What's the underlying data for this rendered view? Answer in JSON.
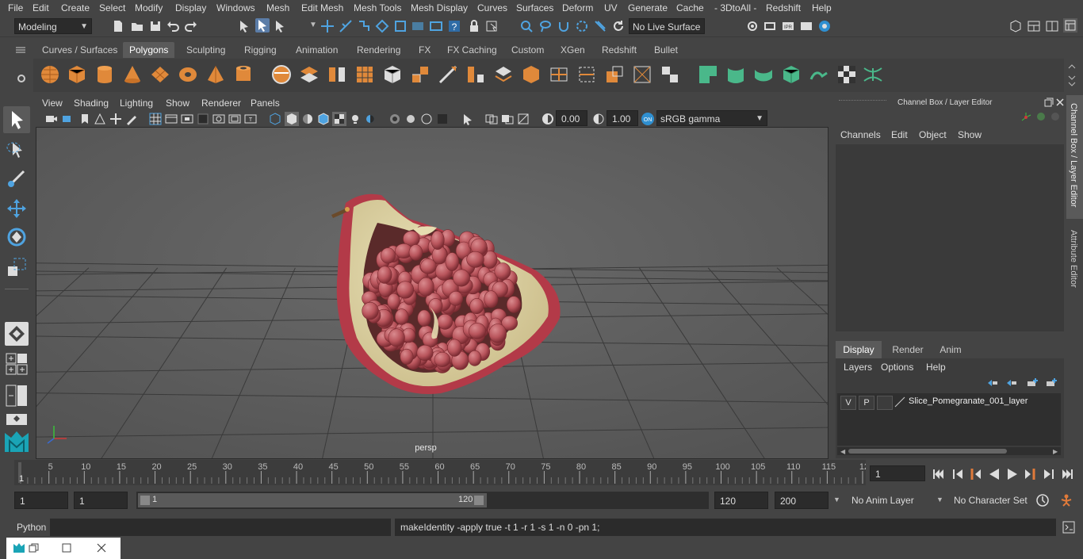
{
  "menu": [
    "File",
    "Edit",
    "Create",
    "Select",
    "Modify",
    "Display",
    "Windows",
    "Mesh",
    "Edit Mesh",
    "Mesh Tools",
    "Mesh Display",
    "Curves",
    "Surfaces",
    "Deform",
    "UV",
    "Generate",
    "Cache",
    "- 3DtoAll -",
    "Redshift",
    "Help"
  ],
  "status": {
    "mode": "Modeling",
    "live_surface": "No Live Surface"
  },
  "shelf_tabs": [
    "Curves / Surfaces",
    "Polygons",
    "Sculpting",
    "Rigging",
    "Animation",
    "Rendering",
    "FX",
    "FX Caching",
    "Custom",
    "XGen",
    "Redshift",
    "Bullet"
  ],
  "active_shelf": "Polygons",
  "viewport": {
    "menu": [
      "View",
      "Shading",
      "Lighting",
      "Show",
      "Renderer",
      "Panels"
    ],
    "exposure": "0.00",
    "gamma": "1.00",
    "colorspace": "sRGB gamma",
    "camera_label": "persp"
  },
  "channel_box": {
    "title": "Channel Box / Layer Editor",
    "menu": [
      "Channels",
      "Edit",
      "Object",
      "Show"
    ],
    "layer_tabs": [
      "Display",
      "Render",
      "Anim"
    ],
    "layer_menu": [
      "Layers",
      "Options",
      "Help"
    ],
    "layer": {
      "v": "V",
      "p": "P",
      "name": "Slice_Pomegranate_001_layer"
    }
  },
  "side_tabs": [
    "Channel Box / Layer Editor",
    "Attribute Editor"
  ],
  "timeline": {
    "ticks": [
      "5",
      "10",
      "15",
      "20",
      "25",
      "30",
      "35",
      "40",
      "45",
      "50",
      "55",
      "60",
      "65",
      "70",
      "75",
      "80",
      "85",
      "90",
      "95",
      "100",
      "105",
      "110",
      "115",
      "12"
    ],
    "start_label": "1",
    "current_frame": "1"
  },
  "range": {
    "start": "1",
    "playback_start": "1",
    "slider_start": "1",
    "slider_end": "120",
    "playback_end": "120",
    "end": "200",
    "anim_layer": "No Anim Layer",
    "character_set": "No Character Set"
  },
  "cmdline": {
    "lang": "Python",
    "result": "makeIdentity -apply true -t 1 -r 1 -s 1 -n 0 -pn 1;"
  }
}
